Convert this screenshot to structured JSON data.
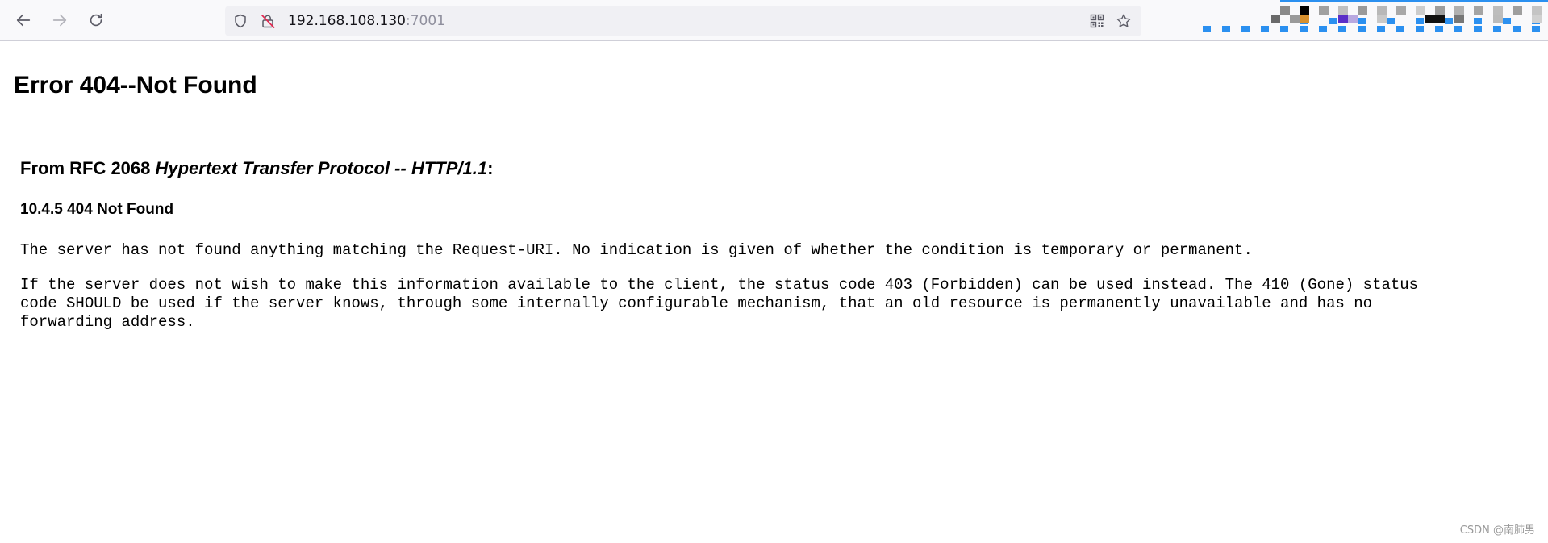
{
  "browser": {
    "url_host": "192.168.108.130",
    "url_port": ":7001",
    "icons": {
      "back": "back-arrow-icon",
      "forward": "forward-arrow-icon",
      "reload": "reload-icon",
      "tracking_protection": "shield-icon",
      "connection": "insecure-lock-icon",
      "qr": "qr-code-icon",
      "bookmark": "star-icon"
    }
  },
  "page": {
    "title": "Error 404--Not Found",
    "rfc_prefix": "From RFC 2068 ",
    "rfc_title": "Hypertext Transfer Protocol -- HTTP/1.1",
    "rfc_suffix": ":",
    "section": "10.4.5 404 Not Found",
    "paragraph1": "The server has not found anything matching the Request-URI. No indication is given of whether the condition is temporary or permanent.",
    "paragraph2": "If the server does not wish to make this information available to the client, the status code 403 (Forbidden) can be used instead. The 410 (Gone) status\ncode SHOULD be used if the server knows, through some internally configurable mechanism, that an old resource is permanently unavailable and has no\nforwarding address."
  },
  "watermark": "CSDN @南肺男",
  "colors": {
    "toolbar_bg": "#f9f9fb",
    "urlbar_bg": "#f0f0f4",
    "port_text": "#8f8f9d",
    "insecure_red": "#e22850",
    "mosaic_blue": "#2b90f0"
  }
}
